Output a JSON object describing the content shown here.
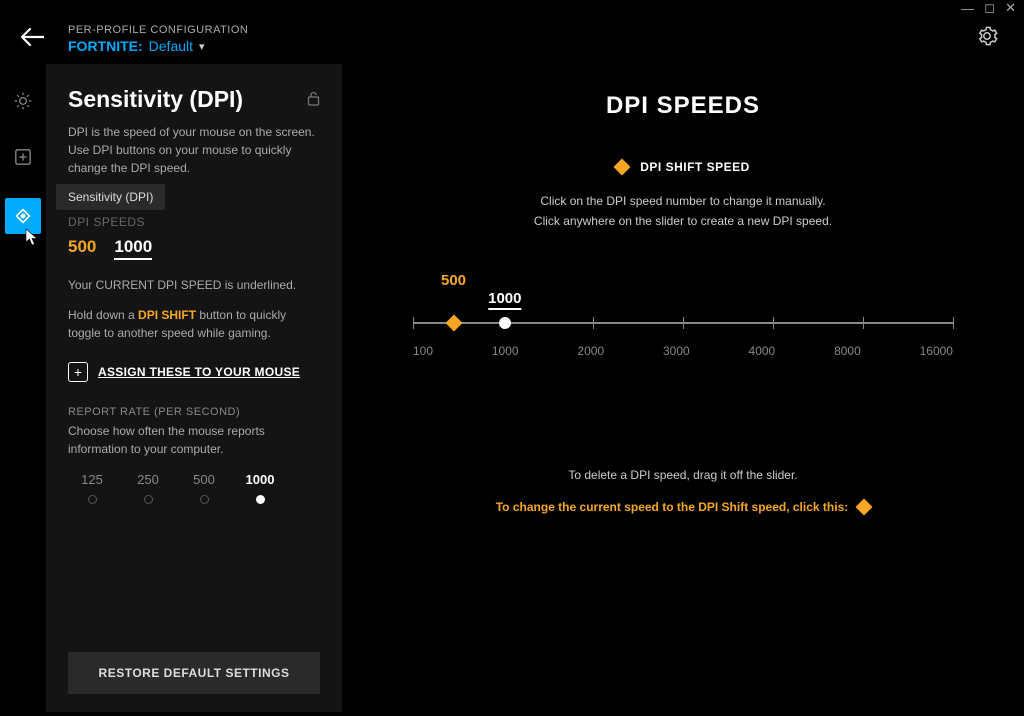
{
  "window": {
    "minimize": "—",
    "maximize": "◻",
    "close": "✕"
  },
  "header": {
    "label": "PER-PROFILE CONFIGURATION",
    "profile_game": "FORTNITE:",
    "profile_name": "Default"
  },
  "sidebar": {
    "title": "Sensitivity (DPI)",
    "desc": "DPI is the speed of your mouse on the screen. Use DPI buttons on your mouse to quickly change the DPI speed.",
    "tooltip": "Sensitivity (DPI)",
    "speeds_heading": "DPI SPEEDS",
    "shift_value": "500",
    "current_value": "1000",
    "current_note": "Your CURRENT DPI SPEED is underlined.",
    "shift_note_a": "Hold down a ",
    "shift_note_hl": "DPI SHIFT",
    "shift_note_b": " button to quickly toggle to another speed while gaming.",
    "assign_label": "ASSIGN THESE TO YOUR MOUSE",
    "report_heading": "REPORT RATE (PER SECOND)",
    "report_desc": "Choose how often the mouse reports information to your computer.",
    "rates": [
      "125",
      "250",
      "500",
      "1000"
    ],
    "selected_rate_index": 3,
    "restore": "RESTORE DEFAULT SETTINGS"
  },
  "main": {
    "title": "DPI SPEEDS",
    "shift_label": "DPI SHIFT SPEED",
    "hint1": "Click on the DPI speed number to change it manually.",
    "hint2": "Click anywhere on the slider to create a new DPI speed.",
    "top_shift": "500",
    "top_current": "1000",
    "scale": [
      "100",
      "1000",
      "2000",
      "3000",
      "4000",
      "8000",
      "16000"
    ],
    "delete_hint": "To delete a DPI speed, drag it off the slider.",
    "change_hint": "To change the current speed to the DPI Shift speed, click this:"
  },
  "colors": {
    "accent_blue": "#00aaff",
    "accent_orange": "#f5a623"
  }
}
